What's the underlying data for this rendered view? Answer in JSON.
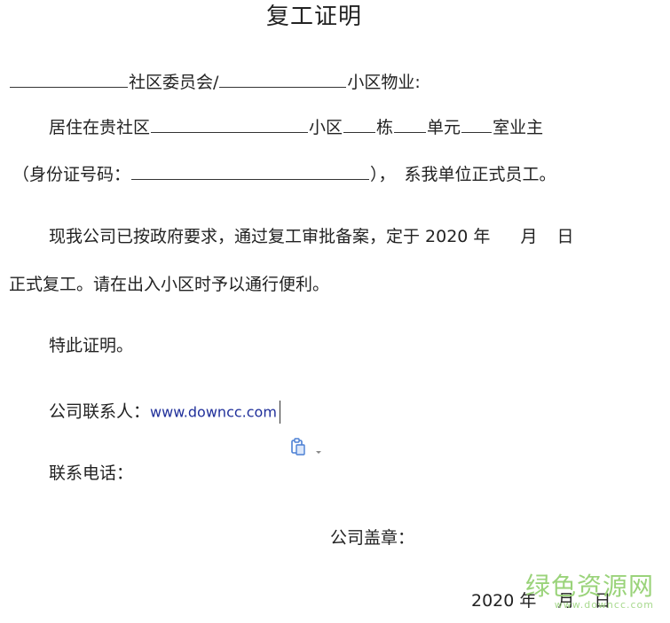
{
  "title": "复工证明",
  "line1": {
    "community_committee": "社区委员会/",
    "property": "小区物业:"
  },
  "line2": {
    "reside": "居住在贵社区",
    "xiaoqu": "小区",
    "building": "栋",
    "unit": "单元",
    "room": "室业主"
  },
  "line3": {
    "id_label": "（身份证号码：",
    "close_paren": "），",
    "employee": "系我单位正式员工。"
  },
  "para1": {
    "text": "现我公司已按政府要求，通过复工审批备案，定于 2020 年",
    "month": "月",
    "day": "日"
  },
  "para2": {
    "text": "正式复工。请在出入小区时予以通行便利。"
  },
  "certify": "特此证明。",
  "contact": {
    "label": "公司联系人：",
    "value": "www.downcc.com"
  },
  "phone": {
    "label": "联系电话："
  },
  "seal": {
    "label": "公司盖章："
  },
  "footer_date": {
    "year": "2020 年",
    "month": "月",
    "day": "日"
  },
  "watermark": {
    "main": "绿色资源网",
    "url": "www.downcc.com"
  },
  "colors": {
    "text": "#222222",
    "link": "#1f2f9a",
    "watermark": "#9ad37a",
    "paste_icon": "#4a7fd4"
  },
  "icons": {
    "paste_options": "clipboard-icon"
  }
}
